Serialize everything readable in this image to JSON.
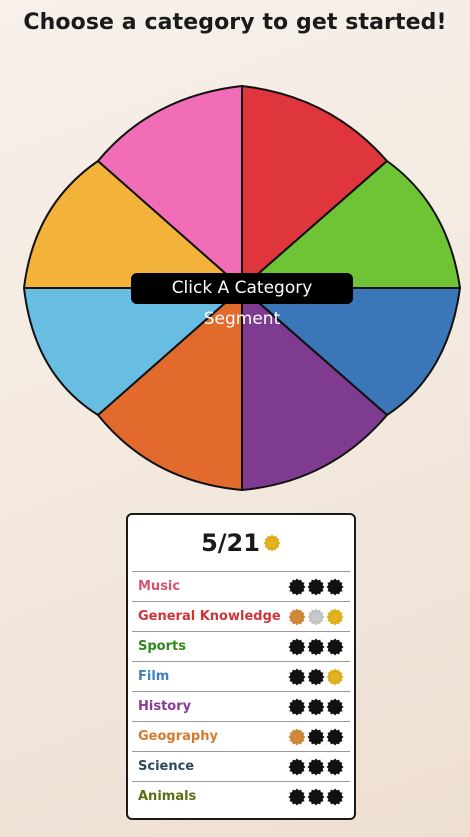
{
  "title": "Choose a category to get started!",
  "wheel": {
    "hint": "Click A Category Segment",
    "segments": [
      {
        "name": "red",
        "color": "#df353c"
      },
      {
        "name": "green",
        "color": "#6fc436"
      },
      {
        "name": "dark-blue",
        "color": "#3b76b8"
      },
      {
        "name": "purple",
        "color": "#7e3b8f"
      },
      {
        "name": "orange",
        "color": "#e16a2c"
      },
      {
        "name": "light-blue",
        "color": "#67bde2"
      },
      {
        "name": "yellow",
        "color": "#f3b33a"
      },
      {
        "name": "pink",
        "color": "#f26db7"
      }
    ]
  },
  "scorecard": {
    "score": "5/21",
    "categories": [
      {
        "name": "Music",
        "color": "#d2556b",
        "badges": [
          "black",
          "black",
          "black"
        ]
      },
      {
        "name": "General Knowledge",
        "color": "#d0343a",
        "badges": [
          "bronze",
          "silver",
          "gold"
        ]
      },
      {
        "name": "Sports",
        "color": "#2f8a1c",
        "badges": [
          "black",
          "black",
          "black"
        ]
      },
      {
        "name": "Film",
        "color": "#3d7fbf",
        "badges": [
          "black",
          "black",
          "gold"
        ]
      },
      {
        "name": "History",
        "color": "#8a3a98",
        "badges": [
          "black",
          "black",
          "black"
        ]
      },
      {
        "name": "Geography",
        "color": "#d87a2e",
        "badges": [
          "bronze",
          "black",
          "black"
        ]
      },
      {
        "name": "Science",
        "color": "#2b4a5e",
        "badges": [
          "black",
          "black",
          "black"
        ]
      },
      {
        "name": "Animals",
        "color": "#5b6f14",
        "badges": [
          "black",
          "black",
          "black"
        ]
      }
    ],
    "badge_colors": {
      "black": "#111111",
      "bronze": "#d08a3a",
      "silver": "#c8c8c8",
      "gold": "#e3b21f"
    }
  }
}
